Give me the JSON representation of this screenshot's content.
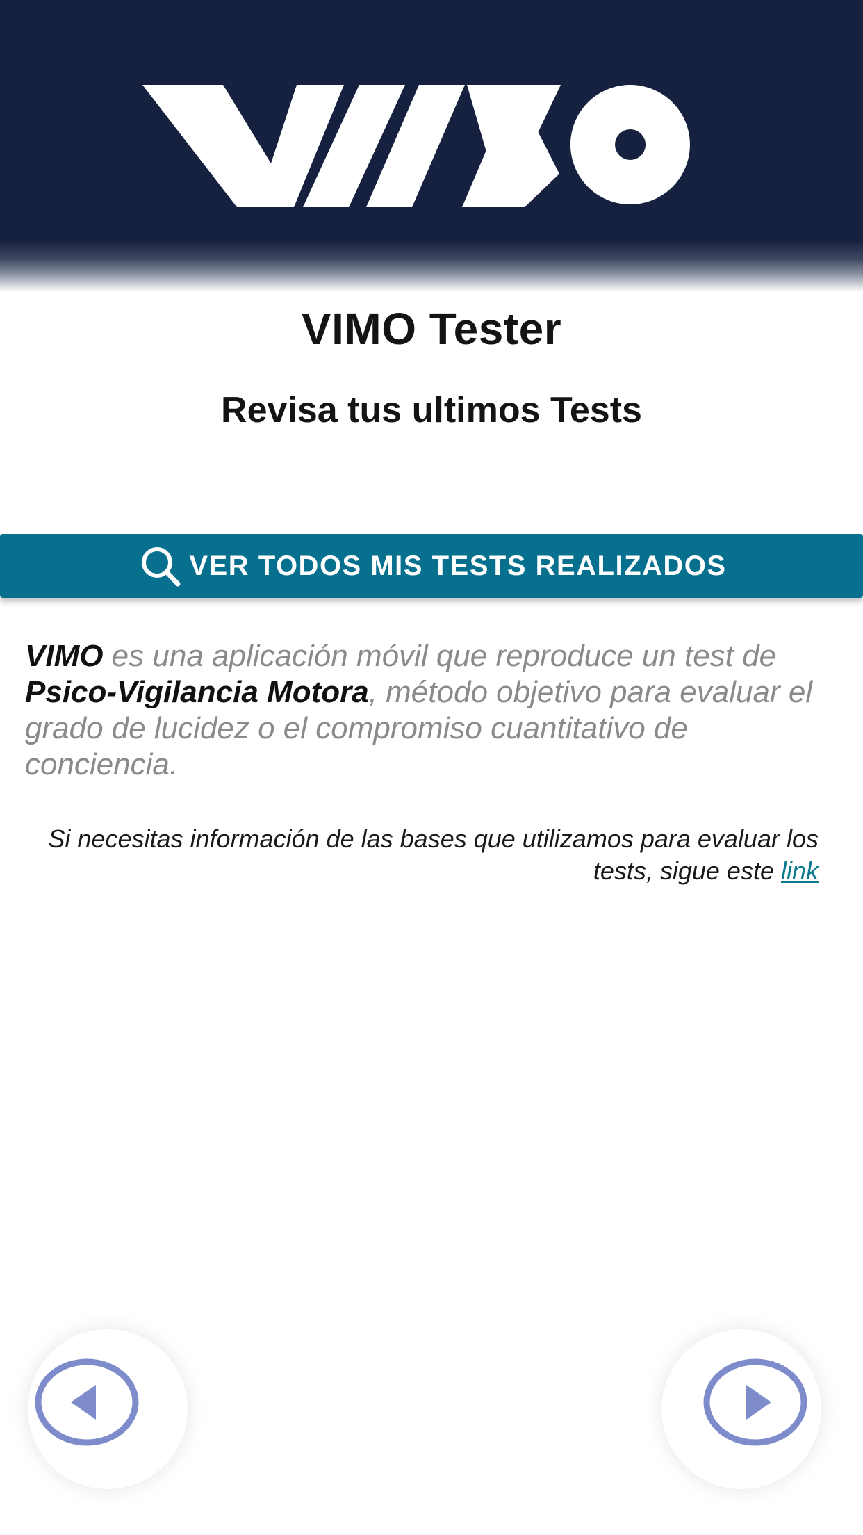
{
  "brand": {
    "logo_text": "VIMO",
    "header_color": "#16213f"
  },
  "page": {
    "title": "VIMO Tester",
    "subtitle": "Revisa tus ultimos Tests"
  },
  "actions": {
    "view_all_tests_label": "VER TODOS MIS TESTS REALIZADOS",
    "view_all_tests_icon": "search-icon",
    "button_color": "#08708f"
  },
  "description": {
    "app_name": "VIMO",
    "text_1": " es una aplicación móvil que reproduce un test de ",
    "test_name": "Psico-Vigilancia Motora",
    "text_2": ", método objetivo para evaluar el grado de lucidez o el compromiso cuantitativo de conciencia."
  },
  "info": {
    "text": "Si necesitas información de las bases que utilizamos para evaluar los tests, sigue este ",
    "link_label": "link",
    "link_color": "#0b7a8f"
  },
  "navigation": {
    "prev_icon": "arrow-left-circle-icon",
    "next_icon": "arrow-right-circle-icon",
    "icon_color": "#7e8ccc"
  }
}
